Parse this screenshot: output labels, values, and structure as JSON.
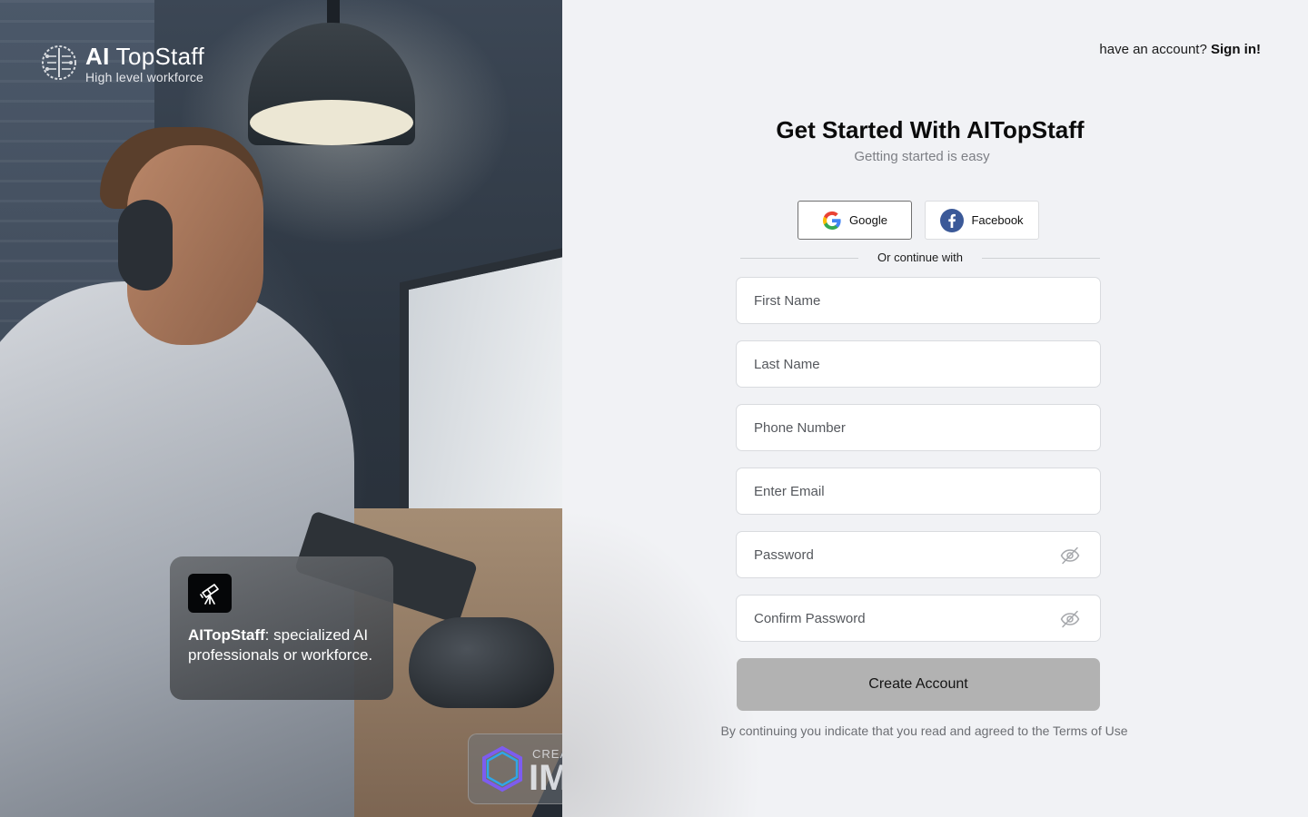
{
  "hero": {
    "brand_name_bold": "AI",
    "brand_name_rest": "TopStaff",
    "brand_tagline": "High level workforce",
    "card_brand": "AITopStaff",
    "card_text": ": specialized AI professionals or workforce.",
    "watermark_small": "CREA",
    "watermark_big": "IM"
  },
  "header": {
    "prompt": "have an account?",
    "signin_label": "Sign in!"
  },
  "form": {
    "title": "Get Started With AITopStaff",
    "subtitle": "Getting started is easy",
    "google_label": "Google",
    "facebook_label": "Facebook",
    "divider_text": "Or continue with",
    "fields": {
      "first_name": {
        "placeholder": "First Name",
        "value": ""
      },
      "last_name": {
        "placeholder": "Last Name",
        "value": ""
      },
      "phone": {
        "placeholder": "Phone Number",
        "value": ""
      },
      "email": {
        "placeholder": "Enter Email",
        "value": ""
      },
      "password": {
        "placeholder": "Password",
        "value": ""
      },
      "confirm_password": {
        "placeholder": "Confirm Password",
        "value": ""
      }
    },
    "submit_label": "Create Account",
    "terms_prefix": "By continuing you indicate that you read and agreed to the ",
    "terms_link": "Terms of Use"
  },
  "icons": {
    "brand": "circuit-brain-icon",
    "card": "telescope-icon",
    "google": "google-g-icon",
    "facebook": "facebook-f-icon",
    "password_toggle": "eye-off-icon"
  },
  "colors": {
    "page_bg": "#f1f2f5",
    "button_disabled": "#b2b2b2",
    "facebook_blue": "#3b5998",
    "text_dark": "#0b0b0b",
    "text_muted": "#7d7f85"
  }
}
